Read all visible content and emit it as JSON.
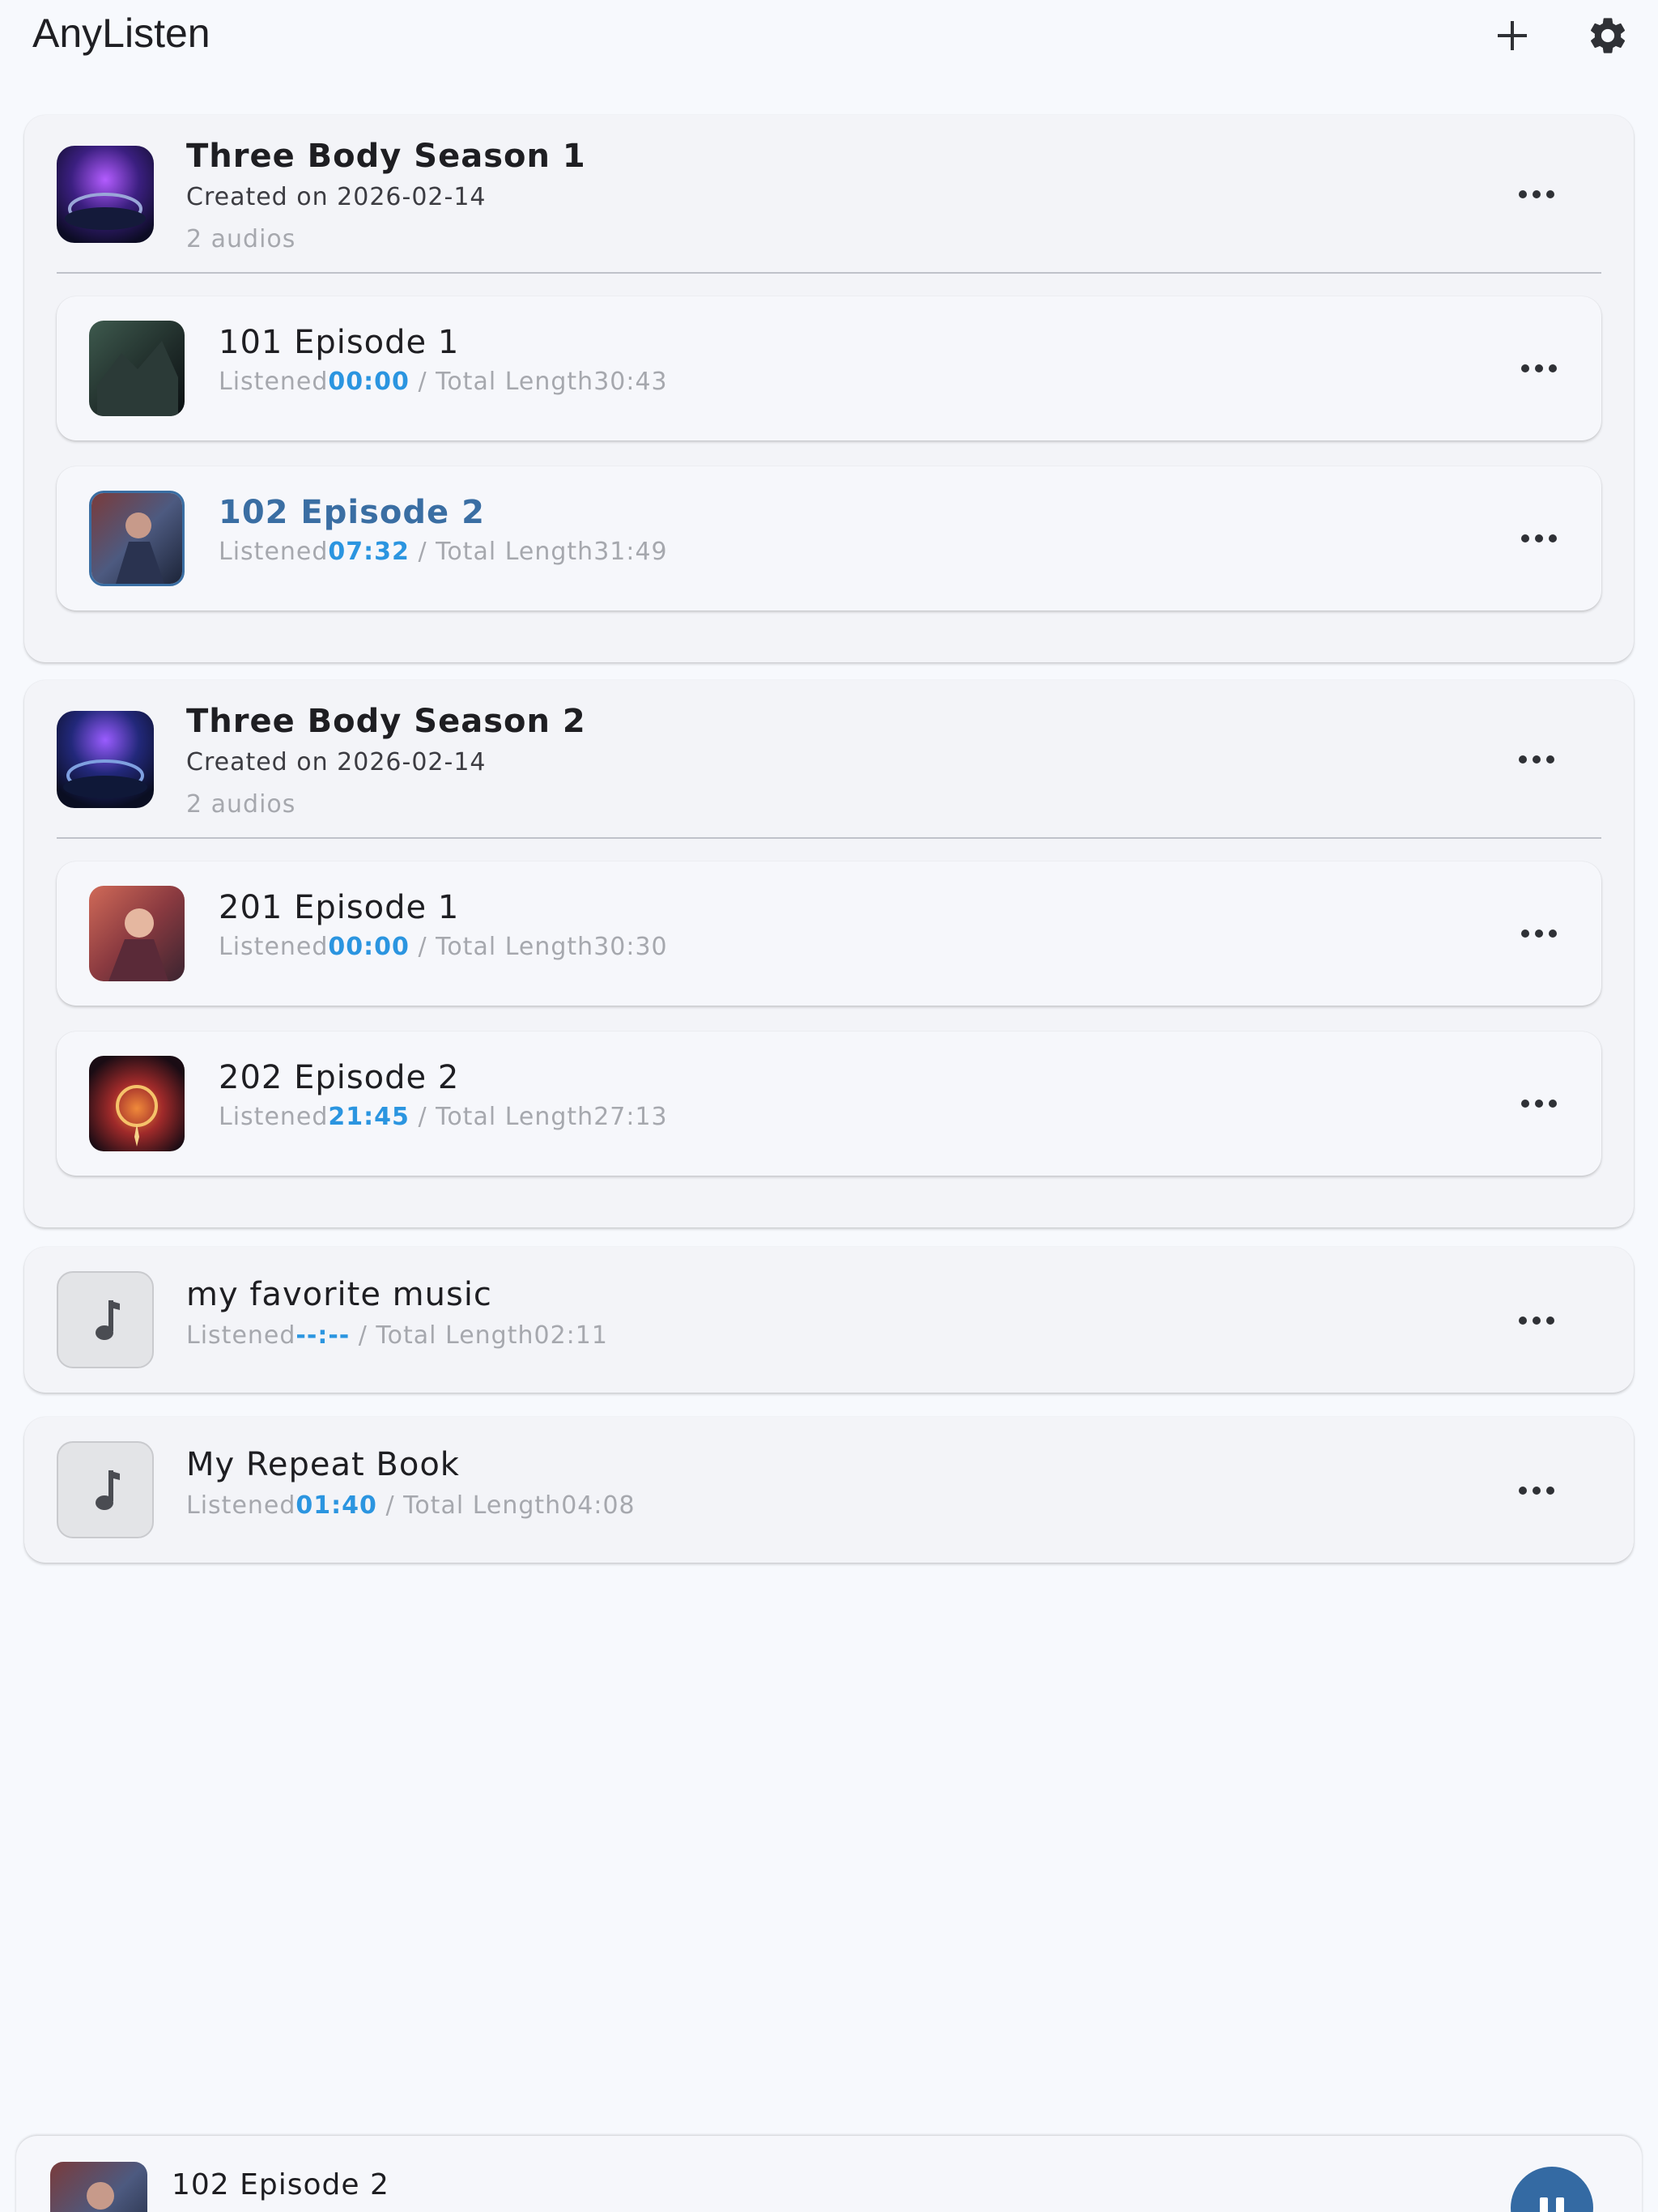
{
  "app": {
    "title": "AnyListen"
  },
  "toolbar": {
    "add_icon": "plus-icon",
    "settings_icon": "gear-icon"
  },
  "collections": [
    {
      "title": "Three Body Season 1",
      "created": "Created on 2026-02-14",
      "count": "2 audios",
      "items": [
        {
          "title": "101 Episode 1",
          "listened_label": "Listened",
          "listened": "00:00",
          "total_label": " / Total Length",
          "total": "30:43",
          "active": false
        },
        {
          "title": "102 Episode 2",
          "listened_label": "Listened",
          "listened": "07:32",
          "total_label": " / Total Length",
          "total": "31:49",
          "active": true
        }
      ]
    },
    {
      "title": "Three Body Season 2",
      "created": "Created on 2026-02-14",
      "count": "2 audios",
      "items": [
        {
          "title": "201 Episode 1",
          "listened_label": "Listened",
          "listened": "00:00",
          "total_label": " / Total Length",
          "total": "30:30",
          "active": false
        },
        {
          "title": "202 Episode 2",
          "listened_label": "Listened",
          "listened": "21:45",
          "total_label": " / Total Length",
          "total": "27:13",
          "active": false
        }
      ]
    }
  ],
  "singles": [
    {
      "title": "my favorite music",
      "listened_label": "Listened",
      "listened": "--:--",
      "total_label": " / Total Length",
      "total": "02:11",
      "icon": "music-note-icon"
    },
    {
      "title": "My Repeat Book",
      "listened_label": "Listened",
      "listened": "01:40",
      "total_label": " / Total Length",
      "total": "04:08",
      "icon": "music-note-icon"
    }
  ],
  "player": {
    "now_playing": "102 Episode 2",
    "state": "playing",
    "button_icon": "pause-icon"
  },
  "colors": {
    "accent": "#2b95e0",
    "active_title": "#3a6ea3",
    "player_button": "#346aa3",
    "background": "#f7f9fd"
  }
}
